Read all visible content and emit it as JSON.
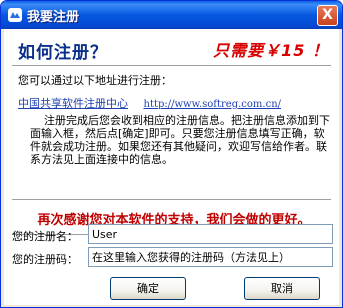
{
  "window": {
    "title": "我要注册",
    "close_glyph": "X"
  },
  "header": {
    "heading": "如何注册？",
    "price": "只需要￥15 ！"
  },
  "body": {
    "instruction": "您可以通过以下地址进行注册：",
    "link_text": "中国共享软件注册中心",
    "link_url": "http://www.softreg.com.cn/",
    "description": "注册完成后您会收到相应的注册信息。把注册信息添加到下面输入框，然后点[确定]即可。只要您注册信息填写正确，软件就会成功注册。如果您还有其他疑问，欢迎写信给作者。联系方法见上面连接中的信息。",
    "thanks": "再次感谢您对本软件的支持，我们会做的更好。"
  },
  "form": {
    "name_label": "您的注册名：",
    "name_value": "User",
    "code_label": "您的注册码：",
    "code_value": "在这里输入您获得的注册码（方法见上）"
  },
  "buttons": {
    "ok": "确定",
    "cancel": "取消"
  },
  "colors": {
    "title_bar": "#0658e0",
    "heading": "#0a2f8a",
    "price": "#d80000",
    "thanks": "#c00000",
    "link": "#1f3fb0"
  }
}
